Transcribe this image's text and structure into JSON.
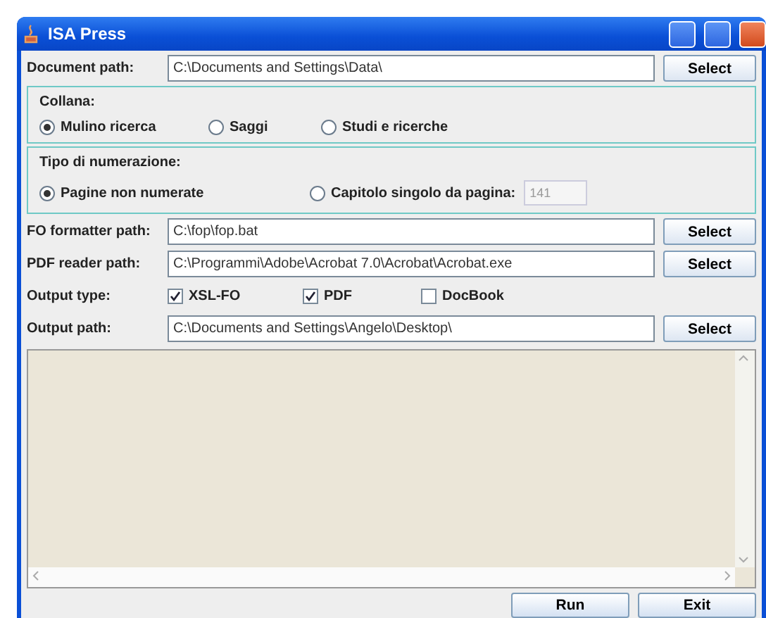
{
  "window": {
    "title": "ISA Press"
  },
  "document_path": {
    "label": "Document path:",
    "value": "C:\\Documents and Settings\\Data\\",
    "button": "Select"
  },
  "collana": {
    "title": "Collana:",
    "options": [
      {
        "label": "Mulino ricerca",
        "selected": true
      },
      {
        "label": "Saggi",
        "selected": false
      },
      {
        "label": "Studi e ricerche",
        "selected": false
      }
    ]
  },
  "numerazione": {
    "title": "Tipo di numerazione:",
    "options": [
      {
        "label": "Pagine non numerate",
        "selected": true
      },
      {
        "label": "Capitolo singolo da pagina:",
        "selected": false
      }
    ],
    "page_field": {
      "value": "141",
      "disabled": true
    }
  },
  "paths": [
    {
      "label": "FO formatter path:",
      "value": "C:\\fop\\fop.bat",
      "button": "Select"
    },
    {
      "label": "PDF reader path:",
      "value": "C:\\Programmi\\Adobe\\Acrobat 7.0\\Acrobat\\Acrobat.exe",
      "button": "Select"
    }
  ],
  "output_type": {
    "label": "Output type:",
    "options": [
      {
        "label": "XSL-FO",
        "checked": true
      },
      {
        "label": "PDF",
        "checked": true
      },
      {
        "label": "DocBook",
        "checked": false
      }
    ]
  },
  "output_path": {
    "label": "Output path:",
    "value": "C:\\Documents and Settings\\Angelo\\Desktop\\",
    "button": "Select"
  },
  "buttons": [
    "Run",
    "Exit"
  ]
}
